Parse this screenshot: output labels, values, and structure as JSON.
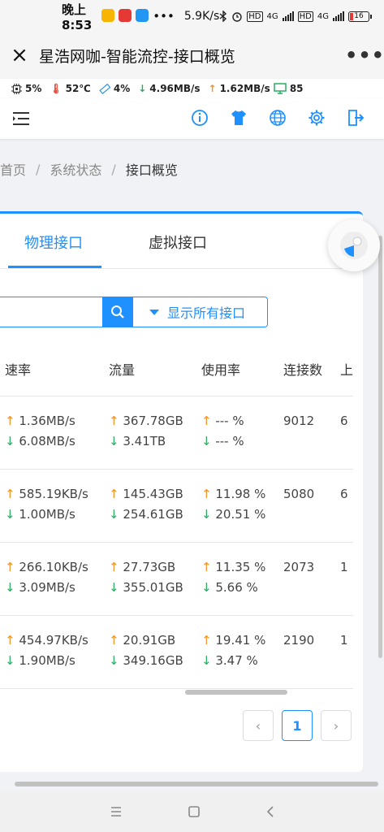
{
  "statusbar": {
    "time": "晚上8:53",
    "speed": "5.9K/s",
    "battery": "16",
    "net1": "4G",
    "net2": "4G",
    "hd": "HD"
  },
  "titlebar": {
    "close": "×",
    "title": "星浩网咖-智能流控-接口概览",
    "more": "•••"
  },
  "infobar": {
    "cpu": "5%",
    "temp": "52℃",
    "mem": "4%",
    "download": "4.96MB/s",
    "upload": "1.62MB/s",
    "online": "85"
  },
  "breadcrumb": {
    "home": "首页",
    "section": "系统状态",
    "current": "接口概览",
    "separator": "/"
  },
  "tabs": {
    "physical": "物理接口",
    "virtual": "虚拟接口"
  },
  "filter": {
    "search_placeholder": "",
    "select_label": "显示所有接口"
  },
  "table": {
    "headers": [
      "速率",
      "流量",
      "使用率",
      "连接数",
      "上"
    ],
    "rows": [
      {
        "rate_up": "1.36MB/s",
        "rate_down": "6.08MB/s",
        "traffic_up": "367.78GB",
        "traffic_down": "3.41TB",
        "usage_up": "--- %",
        "usage_down": "--- %",
        "connections": "9012",
        "extra": "6"
      },
      {
        "rate_up": "585.19KB/s",
        "rate_down": "1.00MB/s",
        "traffic_up": "145.43GB",
        "traffic_down": "254.61GB",
        "usage_up": "11.98 %",
        "usage_down": "20.51 %",
        "connections": "5080",
        "extra": "6"
      },
      {
        "rate_up": "266.10KB/s",
        "rate_down": "3.09MB/s",
        "traffic_up": "27.73GB",
        "traffic_down": "355.01GB",
        "usage_up": "11.35 %",
        "usage_down": "5.66 %",
        "connections": "2073",
        "extra": "1"
      },
      {
        "rate_up": "454.97KB/s",
        "rate_down": "1.90MB/s",
        "traffic_up": "20.91GB",
        "traffic_down": "349.16GB",
        "usage_up": "19.41 %",
        "usage_down": "3.47 %",
        "connections": "2190",
        "extra": "1"
      }
    ]
  },
  "pagination": {
    "prev": "‹",
    "current": "1",
    "next": "›"
  },
  "colors": {
    "accent": "#1e90ff",
    "up": "#f0932b",
    "down": "#27ae60"
  }
}
